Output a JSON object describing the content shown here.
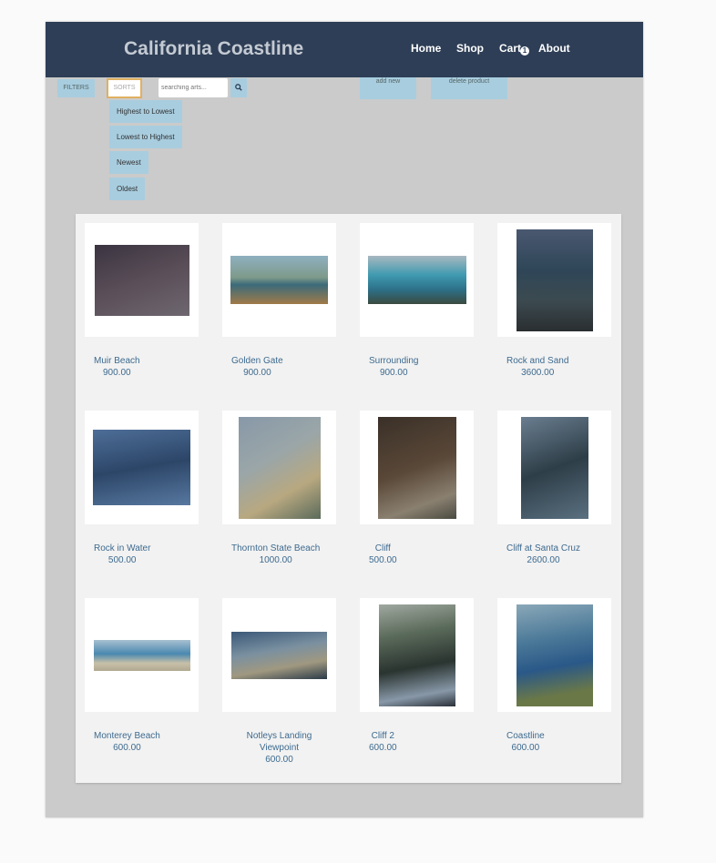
{
  "header": {
    "title": "California Coastline",
    "nav": [
      "Home",
      "Shop",
      "Cart",
      "About"
    ],
    "cart_count": "1"
  },
  "toolbar": {
    "filters": "FILTERS",
    "sorts": "SORTS",
    "search_placeholder": "searching arts...",
    "search_icon": "search-icon",
    "add_new": "add new",
    "delete_product": "delete product"
  },
  "sort_options": [
    "Highest to Lowest",
    "Lowest to Highest",
    "Newest",
    "Oldest"
  ],
  "colors": {
    "header": "#2e3e56",
    "button": "#a8cddf",
    "link": "#3d6a8f"
  },
  "products": [
    {
      "name": "Muir Beach",
      "price": "900.00"
    },
    {
      "name": "Golden Gate",
      "price": "900.00"
    },
    {
      "name": "Surrounding",
      "price": "900.00"
    },
    {
      "name": "Rock and Sand",
      "price": "3600.00"
    },
    {
      "name": "Rock in Water",
      "price": "500.00"
    },
    {
      "name": "Thornton State Beach",
      "price": "1000.00"
    },
    {
      "name": "Cliff",
      "price": "500.00"
    },
    {
      "name": "Cliff at Santa Cruz",
      "price": "2600.00"
    },
    {
      "name": "Monterey Beach",
      "price": "600.00"
    },
    {
      "name": "Notleys Landing Viewpoint",
      "price": "600.00"
    },
    {
      "name": "Cliff 2",
      "price": "600.00"
    },
    {
      "name": "Coastline",
      "price": "600.00"
    }
  ]
}
